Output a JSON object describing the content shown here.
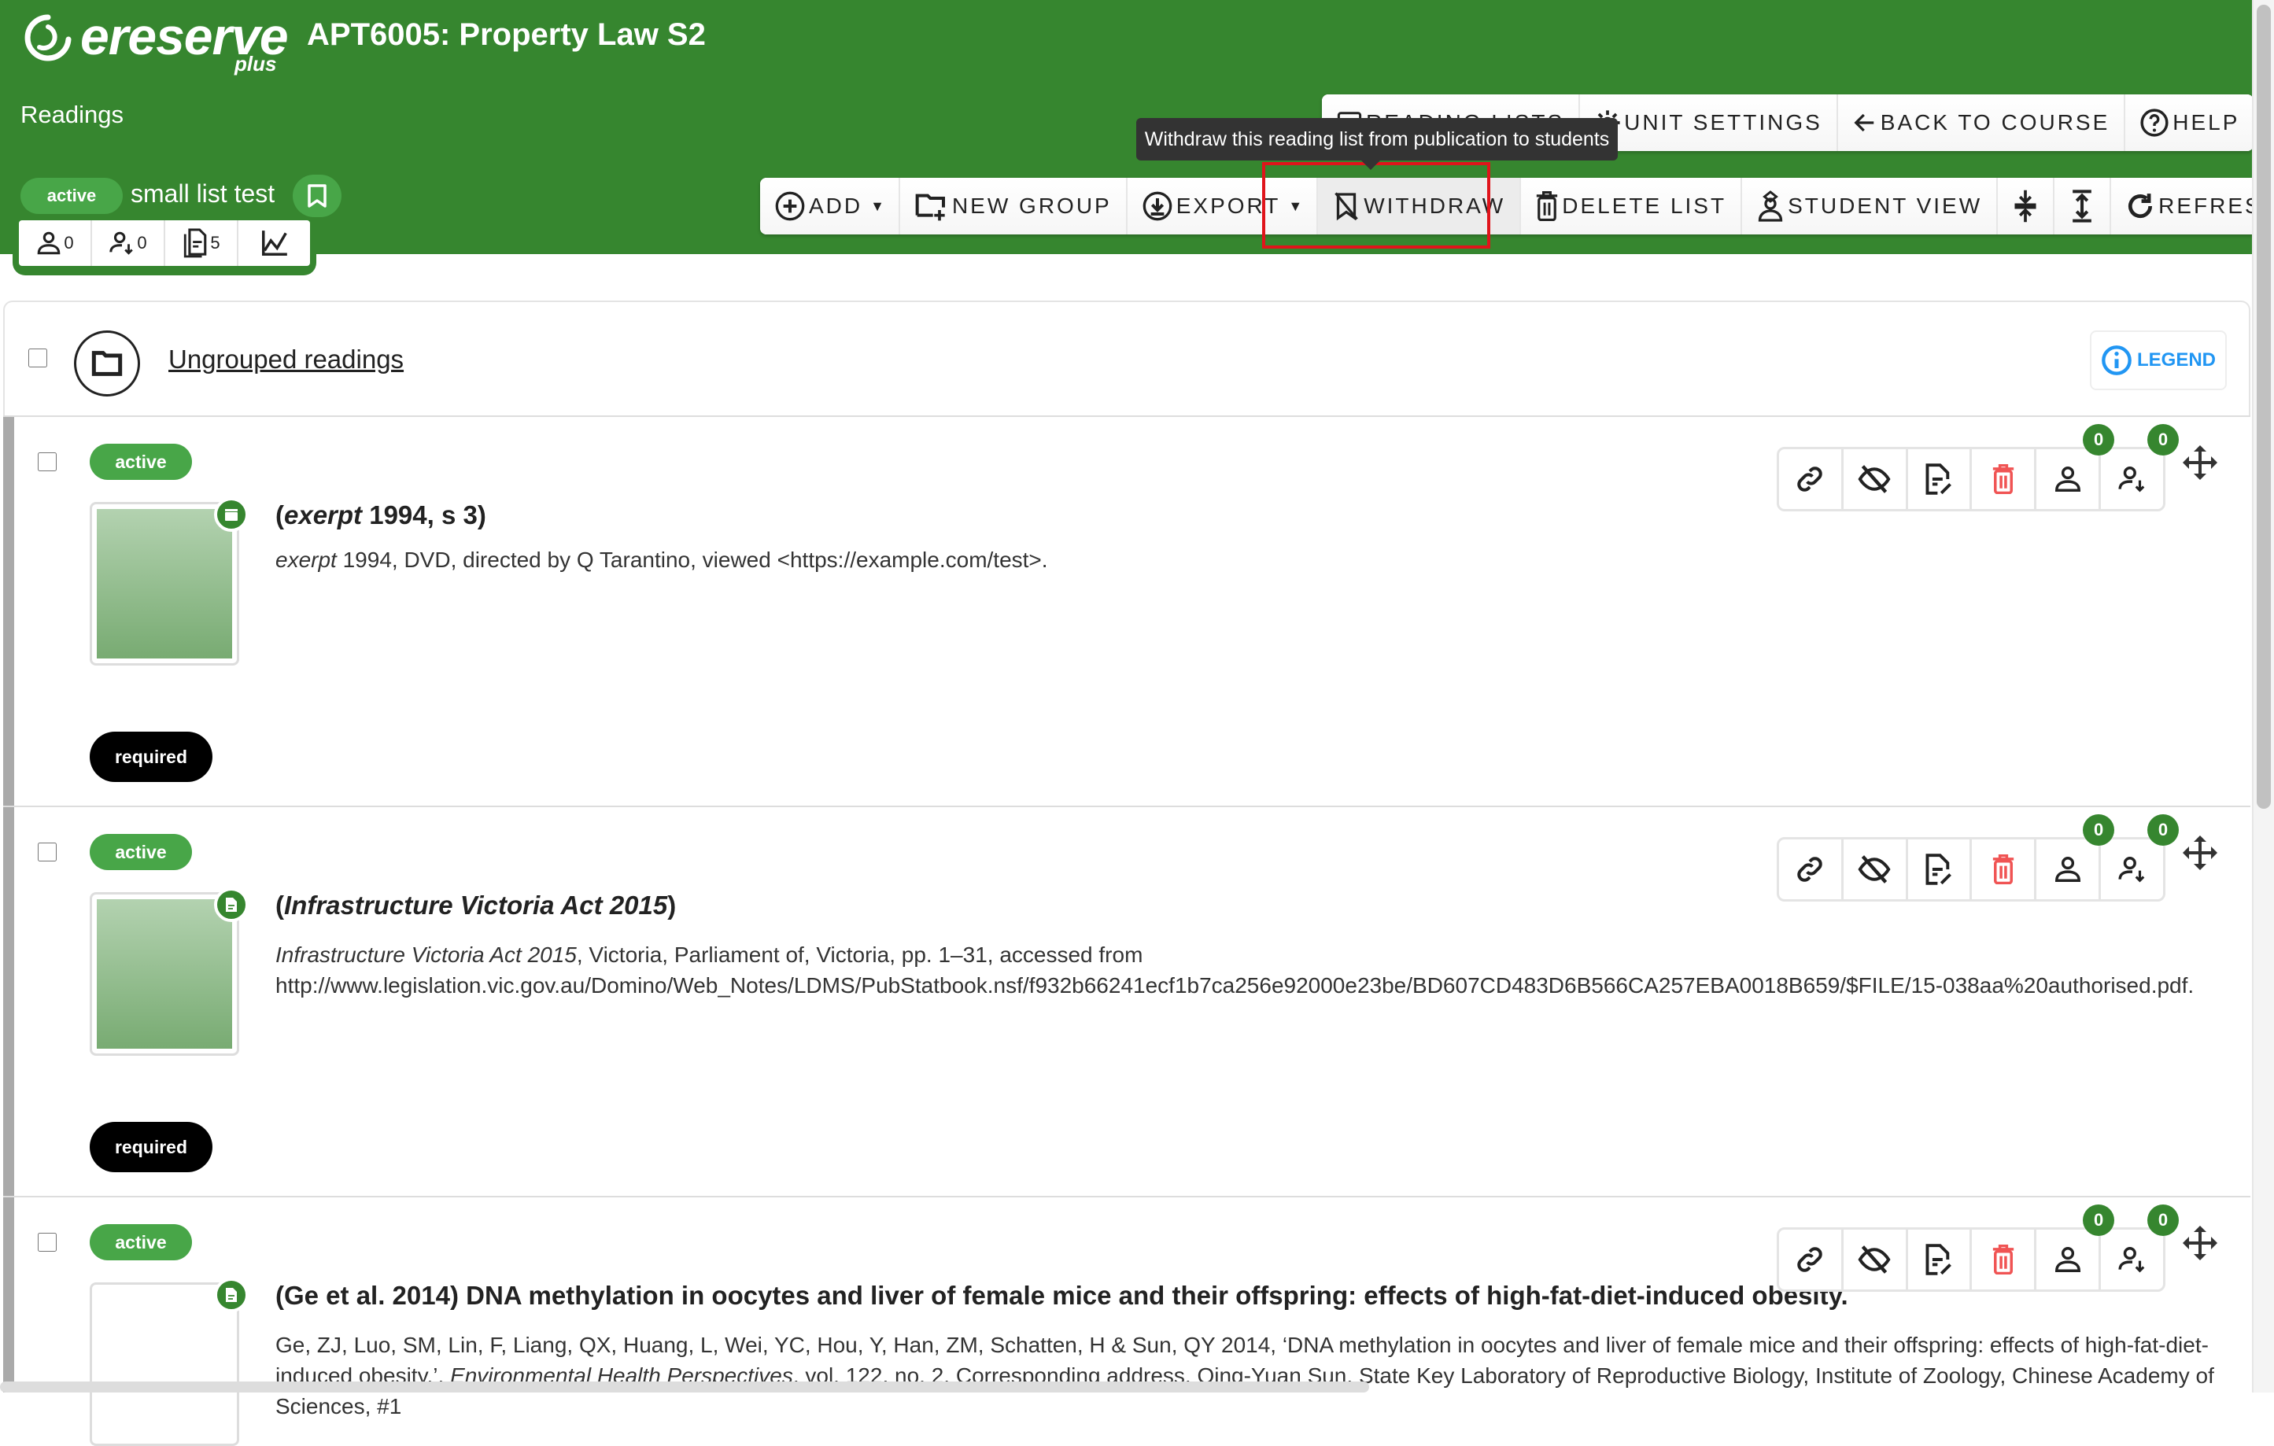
{
  "app": {
    "logo_word": "ereserve",
    "logo_sub": "plus",
    "course_title": "APT6005: Property Law S2",
    "section_title": "Readings"
  },
  "list": {
    "status": "active",
    "name": "small list test"
  },
  "stats": [
    {
      "icon": "student-icon",
      "value": "0"
    },
    {
      "icon": "student-download-icon",
      "value": "0"
    },
    {
      "icon": "documents-icon",
      "value": "5"
    },
    {
      "icon": "analytics-chart-icon",
      "value": ""
    }
  ],
  "topbar": [
    {
      "icon": "list-icon",
      "label": "READING LISTS"
    },
    {
      "icon": "gear-icon",
      "label": "UNIT SETTINGS"
    },
    {
      "icon": "arrow-left-icon",
      "label": "BACK TO COURSE"
    },
    {
      "icon": "help-icon",
      "label": "HELP"
    }
  ],
  "toolbar": [
    {
      "icon": "add-circle-icon",
      "label": "ADD",
      "dropdown": true
    },
    {
      "icon": "new-folder-icon",
      "label": "NEW GROUP"
    },
    {
      "icon": "export-icon",
      "label": "EXPORT",
      "dropdown": true
    },
    {
      "icon": "withdraw-bookmark-icon",
      "label": "WITHDRAW",
      "hovered": true
    },
    {
      "icon": "trash-icon",
      "label": "DELETE LIST"
    },
    {
      "icon": "student-view-icon",
      "label": "STUDENT VIEW"
    },
    {
      "icon": "collapse-icon",
      "label": ""
    },
    {
      "icon": "expand-icon",
      "label": ""
    },
    {
      "icon": "refresh-icon",
      "label": "REFRESH"
    }
  ],
  "tooltip": "Withdraw this reading list from publication to students",
  "group": {
    "title": "Ungrouped readings",
    "legend_label": "LEGEND"
  },
  "colors": {
    "brand_green": "#36862f",
    "badge_green": "#48a648",
    "legend_blue": "#2196f3",
    "danger_red": "#f05454",
    "highlight_red": "#e0141b"
  },
  "readings": [
    {
      "status": "active",
      "requirement": "required",
      "type_icon": "film-icon",
      "title_pre": "(",
      "title_italic": "exerpt",
      "title_post": " 1994, s 3)",
      "cite_italic": "exerpt",
      "cite_rest": " 1994, DVD, directed by Q Tarantino, viewed <https://example.com/test>.",
      "cite_italic2": "",
      "cite_rest2": "",
      "student_count": "0",
      "download_count": "0"
    },
    {
      "status": "active",
      "requirement": "required",
      "type_icon": "document-icon",
      "title_pre": "(",
      "title_italic": "Infrastructure Victoria Act 2015",
      "title_post": ")",
      "cite_italic": "Infrastructure Victoria Act 2015",
      "cite_rest": ", Victoria, Parliament of, Victoria, pp. 1–31, accessed from http://www.legislation.vic.gov.au/Domino/Web_Notes/LDMS/PubStatbook.nsf/f932b66241ecf1b7ca256e92000e23be/BD607CD483D6B566CA257EBA0018B659/$FILE/15-038aa%20authorised.pdf.",
      "cite_italic2": "",
      "cite_rest2": "",
      "student_count": "0",
      "download_count": "0"
    },
    {
      "status": "active",
      "requirement": "",
      "type_icon": "document-icon",
      "title_pre": "(Ge et al. 2014) DNA methylation in oocytes and liver of female mice and their offspring: effects of high-fat-diet-induced obesity.",
      "title_italic": "",
      "title_post": "",
      "cite_italic": "",
      "cite_rest": "Ge, ZJ, Luo, SM, Lin, F, Liang, QX, Huang, L, Wei, YC, Hou, Y, Han, ZM, Schatten, H & Sun, QY 2014, ‘DNA methylation in oocytes and liver of female mice and their offspring: effects of high-fat-diet-induced obesity.’, ",
      "cite_italic2": "Environmental Health Perspectives",
      "cite_rest2": ", vol. 122, no. 2, Corresponding address, Qing-Yuan Sun, State Key Laboratory of Reproductive Biology, Institute of Zoology, Chinese Academy of Sciences, #1",
      "student_count": "0",
      "download_count": "0"
    }
  ],
  "reading_actions": [
    {
      "icon": "link-icon"
    },
    {
      "icon": "hide-eye-icon"
    },
    {
      "icon": "edit-document-icon"
    },
    {
      "icon": "delete-icon"
    },
    {
      "icon": "student-icon"
    },
    {
      "icon": "student-download-icon"
    }
  ]
}
